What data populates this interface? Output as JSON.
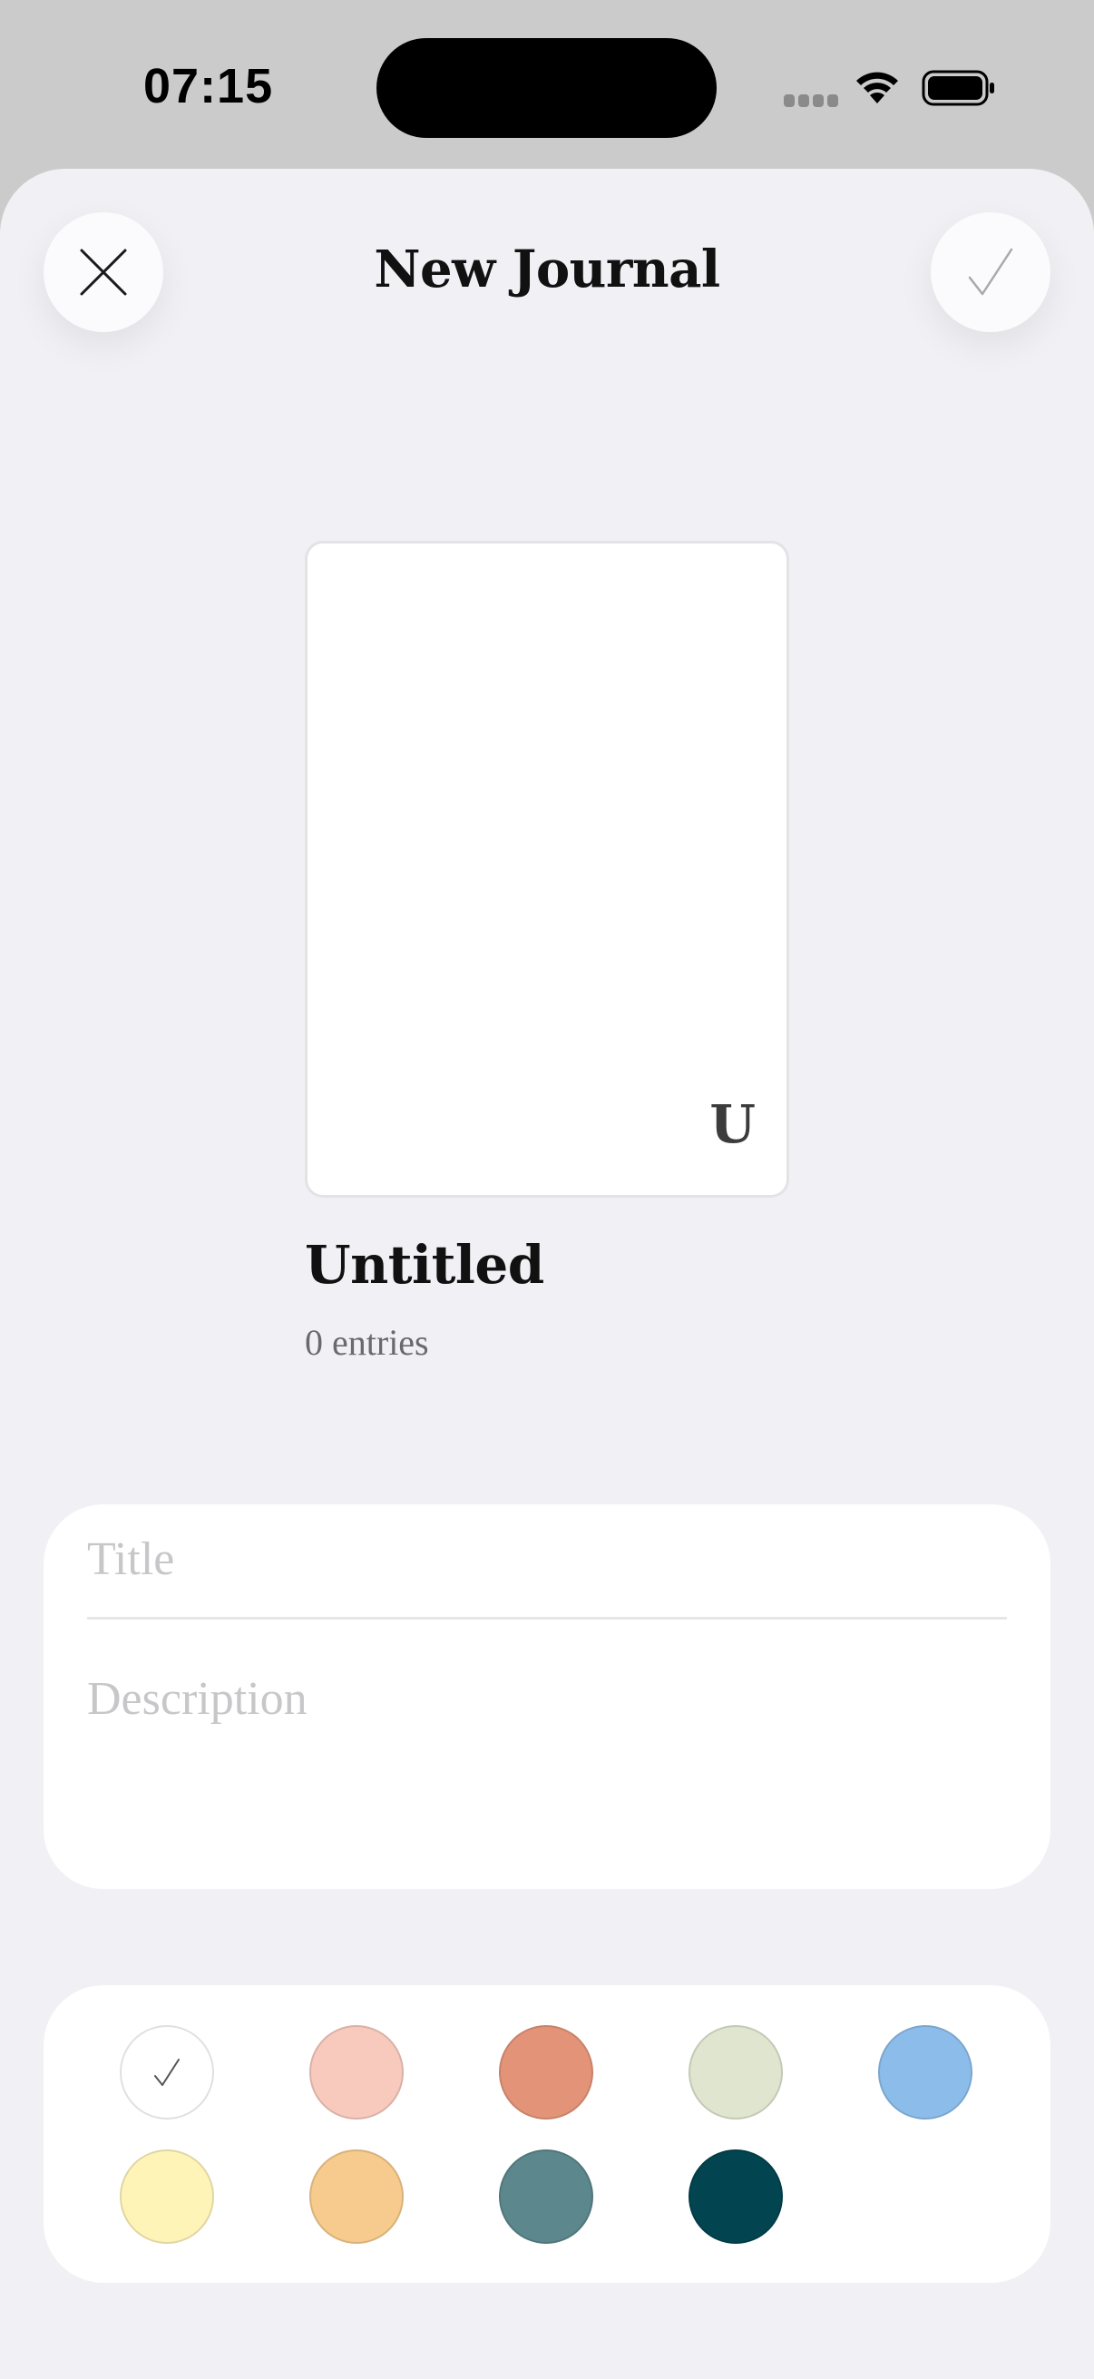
{
  "status_bar": {
    "time": "07:15"
  },
  "header": {
    "title": "New Journal",
    "close_icon": "close-icon",
    "done_icon": "checkmark-icon"
  },
  "preview": {
    "initial": "U",
    "name": "Untitled",
    "count": "0 entries"
  },
  "form": {
    "title_placeholder": "Title",
    "title_value": "",
    "description_placeholder": "Description",
    "description_value": ""
  },
  "colors": {
    "selected": "#ffffff",
    "swatches": [
      "#ffffff",
      "#f8cabd",
      "#e39478",
      "#e0e5cf",
      "#8cbdea",
      "#fff4b8",
      "#f6cb8d",
      "#5c878c",
      "#024550"
    ]
  }
}
